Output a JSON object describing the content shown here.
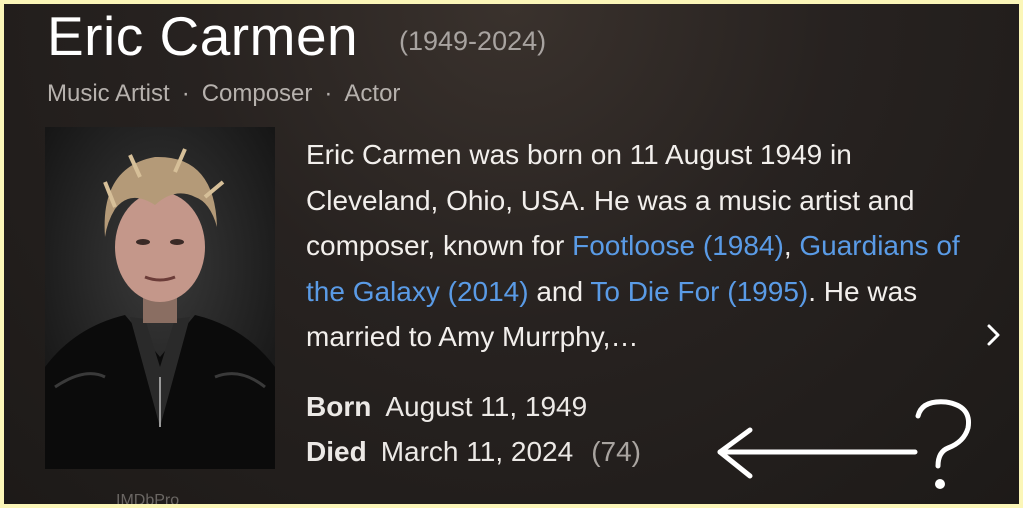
{
  "header": {
    "name": "Eric Carmen",
    "years": "(1949-2024)"
  },
  "roles": [
    "Music Artist",
    "Composer",
    "Actor"
  ],
  "role_separator": "·",
  "photo": {
    "label": "IMDbPro"
  },
  "bio": {
    "t1": "Eric Carmen was born on 11 August 1949 in Cleveland, Ohio, USA. He was a music artist and composer, known for ",
    "link1": "Footloose (1984)",
    "t2": ", ",
    "link2": "Guardians of the Galaxy (2014)",
    "t3": " and ",
    "link3": "To Die For (1995)",
    "t4": ". He was married to Amy Murrphy,…"
  },
  "facts": {
    "born_label": "Born",
    "born_value": "August 11, 1949",
    "died_label": "Died",
    "died_value": "March 11, 2024",
    "died_age": "(74)"
  },
  "icons": {
    "more": "chevron-right-icon",
    "annotation": "arrow-left-question-icon"
  },
  "colors": {
    "link": "#5a9be6",
    "frame_border": "#fbf6b8"
  }
}
